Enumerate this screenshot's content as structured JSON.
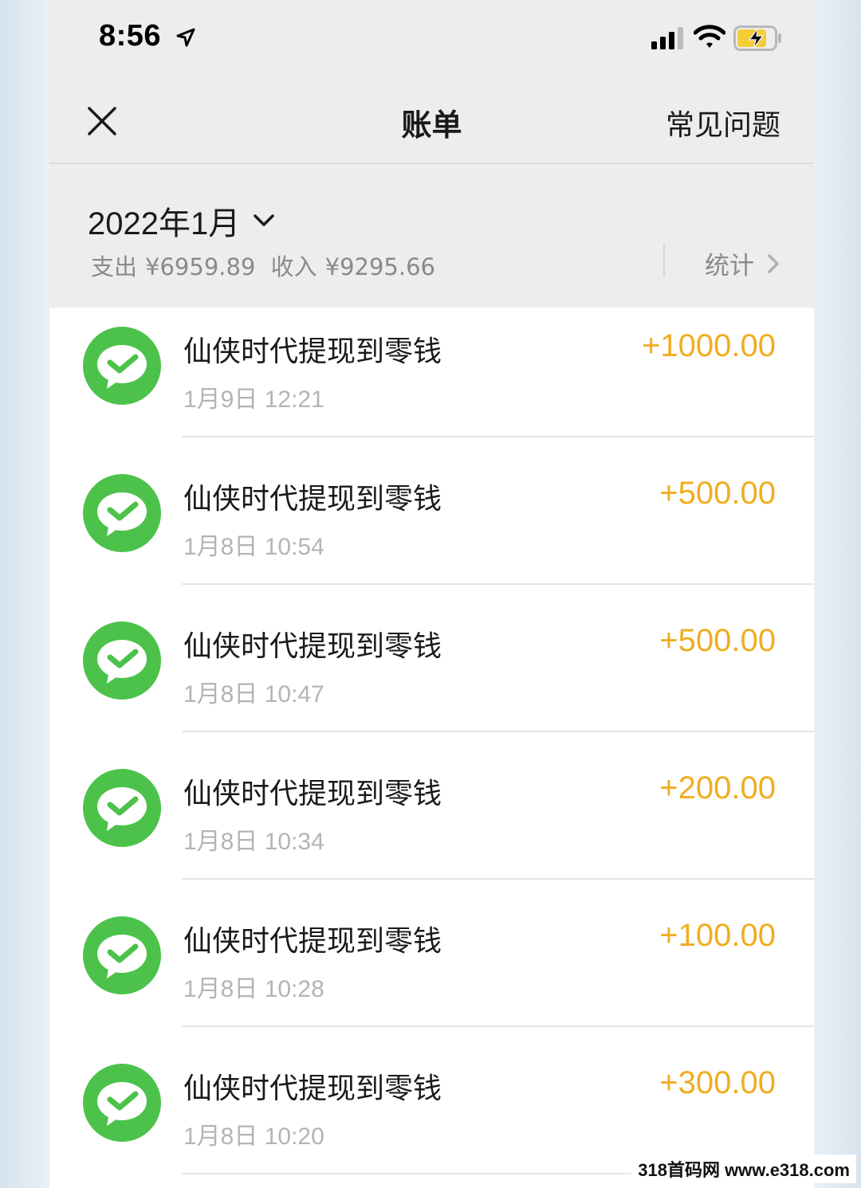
{
  "status_bar": {
    "time": "8:56"
  },
  "nav": {
    "title": "账单",
    "faq_label": "常见问题"
  },
  "summary": {
    "month": "2022年1月",
    "expense_label": "支出",
    "expense_value": "¥6959.89",
    "income_label": "收入",
    "income_value": "¥9295.66",
    "stats_label": "统计"
  },
  "transactions": [
    {
      "title": "仙侠时代提现到零钱",
      "time": "1月9日 12:21",
      "amount": "+1000.00"
    },
    {
      "title": "仙侠时代提现到零钱",
      "time": "1月8日 10:54",
      "amount": "+500.00"
    },
    {
      "title": "仙侠时代提现到零钱",
      "time": "1月8日 10:47",
      "amount": "+500.00"
    },
    {
      "title": "仙侠时代提现到零钱",
      "time": "1月8日 10:34",
      "amount": "+200.00"
    },
    {
      "title": "仙侠时代提现到零钱",
      "time": "1月8日 10:28",
      "amount": "+100.00"
    },
    {
      "title": "仙侠时代提现到零钱",
      "time": "1月8日 10:20",
      "amount": "+300.00"
    }
  ],
  "colors": {
    "amount": "#f0ad20",
    "icon_green": "#4cc24a",
    "background": "#ededed"
  },
  "watermark": "318首码网 www.e318.com"
}
